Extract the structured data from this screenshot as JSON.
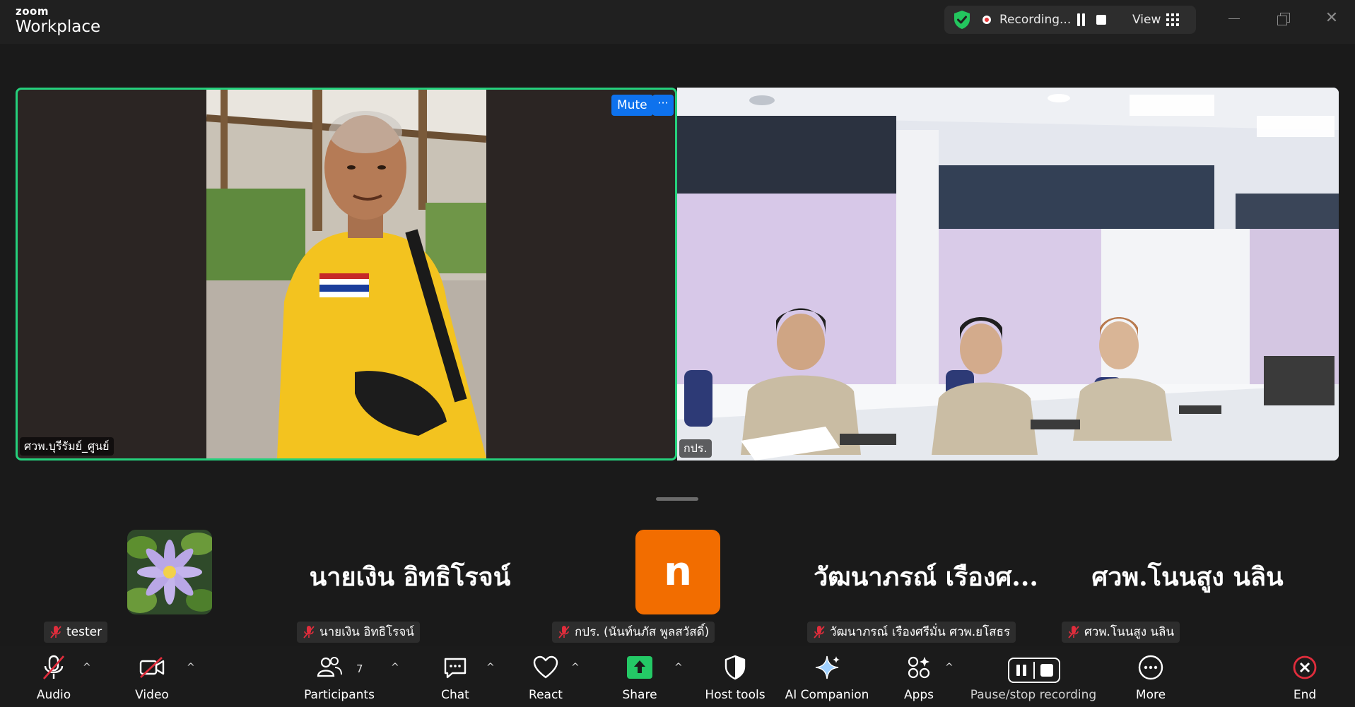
{
  "app": {
    "brand_small": "zoom",
    "brand_large": "Workplace"
  },
  "titlebar": {
    "recording_text": "Recording...",
    "view_label": "View",
    "close_glyph": "✕"
  },
  "tiles": {
    "left": {
      "name": "ศวพ.บุรีรัมย์_ศูนย์",
      "mute_label": "Mute",
      "more_glyph": "···",
      "highlight_color": "#25d07c"
    },
    "right": {
      "name": "กปร."
    }
  },
  "participants": [
    {
      "big_name": "",
      "label": "tester",
      "avatar": "lotus-image"
    },
    {
      "big_name": "นายเงิน  อิทธิโรจน์",
      "label": "นายเงิน  อิทธิโรจน์",
      "avatar": "name"
    },
    {
      "big_name": "",
      "label": "กปร. (นันท์นภัส พูลสวัสดิ์)",
      "avatar_letter": "n",
      "avatar_color": "#f26d00"
    },
    {
      "big_name": "วัฒนาภรณ์  เรืองศ...",
      "label": "วัฒนาภรณ์  เรืองศรีมั่น ศวพ.ยโสธร",
      "avatar": "name"
    },
    {
      "big_name": "ศวพ.โนนสูง นลิน",
      "label": "ศวพ.โนนสูง นลิน",
      "avatar": "name"
    }
  ],
  "toolbar": {
    "audio": "Audio",
    "video": "Video",
    "participants": "Participants",
    "participants_count": "7",
    "chat": "Chat",
    "react": "React",
    "share": "Share",
    "host_tools": "Host tools",
    "ai_companion": "AI Companion",
    "apps": "Apps",
    "pause_stop": "Pause/stop recording",
    "more": "More",
    "end": "End",
    "caret": "^"
  },
  "colors": {
    "share_green": "#24c966",
    "end_red": "#e02d3c",
    "mute_blue": "#0e72ed",
    "security_green": "#23c55e"
  }
}
